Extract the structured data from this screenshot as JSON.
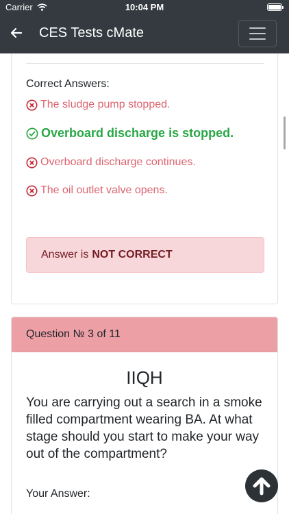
{
  "status_bar": {
    "carrier": "Carrier",
    "time": "10:04 PM"
  },
  "navbar": {
    "title": "CES Tests cMate"
  },
  "previous_question": {
    "correct_answers_label": "Correct Answers:",
    "answers": [
      {
        "text": "The sludge pump stopped.",
        "correct": false
      },
      {
        "text": "Overboard discharge is stopped.",
        "correct": true
      },
      {
        "text": "Overboard discharge continues.",
        "correct": false
      },
      {
        "text": "The oil outlet valve opens.",
        "correct": false
      }
    ],
    "result_prefix": "Answer is",
    "result_status": "NOT CORRECT"
  },
  "question": {
    "header": "Question № 3 of 11",
    "code": "IIQH",
    "text": "You are carrying out a search in a smoke filled compartment wearing BA. At what stage should you start to make your way out of the compartment?",
    "your_answer_label": "Your Answer:"
  },
  "colors": {
    "navbar": "#343a40",
    "wrong": "#dc6470",
    "right": "#28a745",
    "alert_bg": "#f8d7da",
    "question_header_bg": "#eca0a6"
  }
}
